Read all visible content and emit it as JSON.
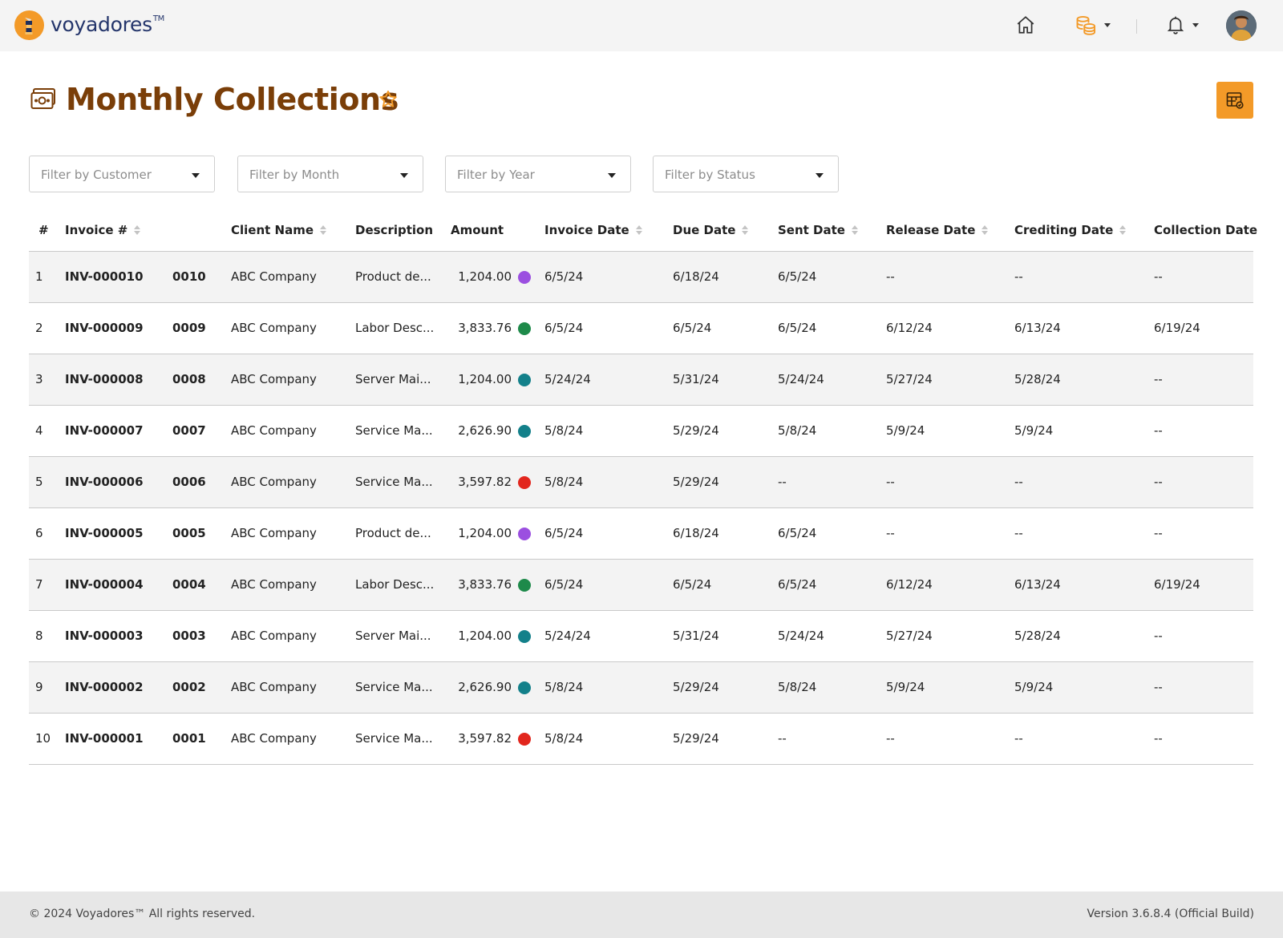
{
  "brand": {
    "name": "voyadores",
    "tm": "TM"
  },
  "header": {
    "icons": [
      "home-icon",
      "coins-icon",
      "bell-icon",
      "avatar"
    ]
  },
  "page": {
    "title": "Monthly Collections",
    "icon": "money-icon",
    "favorite_icon": "star-icon",
    "export_icon": "table-export-icon"
  },
  "filters": [
    {
      "placeholder": "Filter by Customer"
    },
    {
      "placeholder": "Filter by Month"
    },
    {
      "placeholder": "Filter by Year"
    },
    {
      "placeholder": "Filter by Status"
    }
  ],
  "table": {
    "columns": [
      "#",
      "Invoice #",
      "Client Name",
      "Description",
      "Amount",
      "Invoice Date",
      "Due Date",
      "Sent Date",
      "Release Date",
      "Crediting Date",
      "Collection Date"
    ],
    "status_colors": {
      "purple": "#9b4fe0",
      "green": "#1e8a4a",
      "teal": "#13808a",
      "red": "#e2261d"
    },
    "rows": [
      {
        "n": "1",
        "invoice": "INV-000010",
        "ref": "0010",
        "client": "ABC Company",
        "desc": "Product de...",
        "amount": "1,204.00",
        "status": "purple",
        "inv_date": "6/5/24",
        "due": "6/18/24",
        "sent": "6/5/24",
        "release": "--",
        "credit": "--",
        "collect": "--"
      },
      {
        "n": "2",
        "invoice": "INV-000009",
        "ref": "0009",
        "client": "ABC Company",
        "desc": "Labor Desc...",
        "amount": "3,833.76",
        "status": "green",
        "inv_date": "6/5/24",
        "due": "6/5/24",
        "sent": "6/5/24",
        "release": "6/12/24",
        "credit": "6/13/24",
        "collect": "6/19/24"
      },
      {
        "n": "3",
        "invoice": "INV-000008",
        "ref": "0008",
        "client": "ABC Company",
        "desc": "Server Mai...",
        "amount": "1,204.00",
        "status": "teal",
        "inv_date": "5/24/24",
        "due": "5/31/24",
        "sent": "5/24/24",
        "release": "5/27/24",
        "credit": "5/28/24",
        "collect": "--"
      },
      {
        "n": "4",
        "invoice": "INV-000007",
        "ref": "0007",
        "client": "ABC Company",
        "desc": "Service Ma...",
        "amount": "2,626.90",
        "status": "teal",
        "inv_date": "5/8/24",
        "due": "5/29/24",
        "sent": "5/8/24",
        "release": "5/9/24",
        "credit": "5/9/24",
        "collect": "--"
      },
      {
        "n": "5",
        "invoice": "INV-000006",
        "ref": "0006",
        "client": "ABC Company",
        "desc": "Service Ma...",
        "amount": "3,597.82",
        "status": "red",
        "inv_date": "5/8/24",
        "due": "5/29/24",
        "sent": "--",
        "release": "--",
        "credit": "--",
        "collect": "--"
      },
      {
        "n": "6",
        "invoice": "INV-000005",
        "ref": "0005",
        "client": "ABC Company",
        "desc": "Product de...",
        "amount": "1,204.00",
        "status": "purple",
        "inv_date": "6/5/24",
        "due": "6/18/24",
        "sent": "6/5/24",
        "release": "--",
        "credit": "--",
        "collect": "--"
      },
      {
        "n": "7",
        "invoice": "INV-000004",
        "ref": "0004",
        "client": "ABC Company",
        "desc": "Labor Desc...",
        "amount": "3,833.76",
        "status": "green",
        "inv_date": "6/5/24",
        "due": "6/5/24",
        "sent": "6/5/24",
        "release": "6/12/24",
        "credit": "6/13/24",
        "collect": "6/19/24"
      },
      {
        "n": "8",
        "invoice": "INV-000003",
        "ref": "0003",
        "client": "ABC Company",
        "desc": "Server Mai...",
        "amount": "1,204.00",
        "status": "teal",
        "inv_date": "5/24/24",
        "due": "5/31/24",
        "sent": "5/24/24",
        "release": "5/27/24",
        "credit": "5/28/24",
        "collect": "--"
      },
      {
        "n": "9",
        "invoice": "INV-000002",
        "ref": "0002",
        "client": "ABC Company",
        "desc": "Service Ma...",
        "amount": "2,626.90",
        "status": "teal",
        "inv_date": "5/8/24",
        "due": "5/29/24",
        "sent": "5/8/24",
        "release": "5/9/24",
        "credit": "5/9/24",
        "collect": "--"
      },
      {
        "n": "10",
        "invoice": "INV-000001",
        "ref": "0001",
        "client": "ABC Company",
        "desc": "Service Ma...",
        "amount": "3,597.82",
        "status": "red",
        "inv_date": "5/8/24",
        "due": "5/29/24",
        "sent": "--",
        "release": "--",
        "credit": "--",
        "collect": "--"
      }
    ]
  },
  "footer": {
    "copyright": "© 2024 Voyadores™ All rights reserved.",
    "version": "Version 3.6.8.4 (Official Build)"
  }
}
